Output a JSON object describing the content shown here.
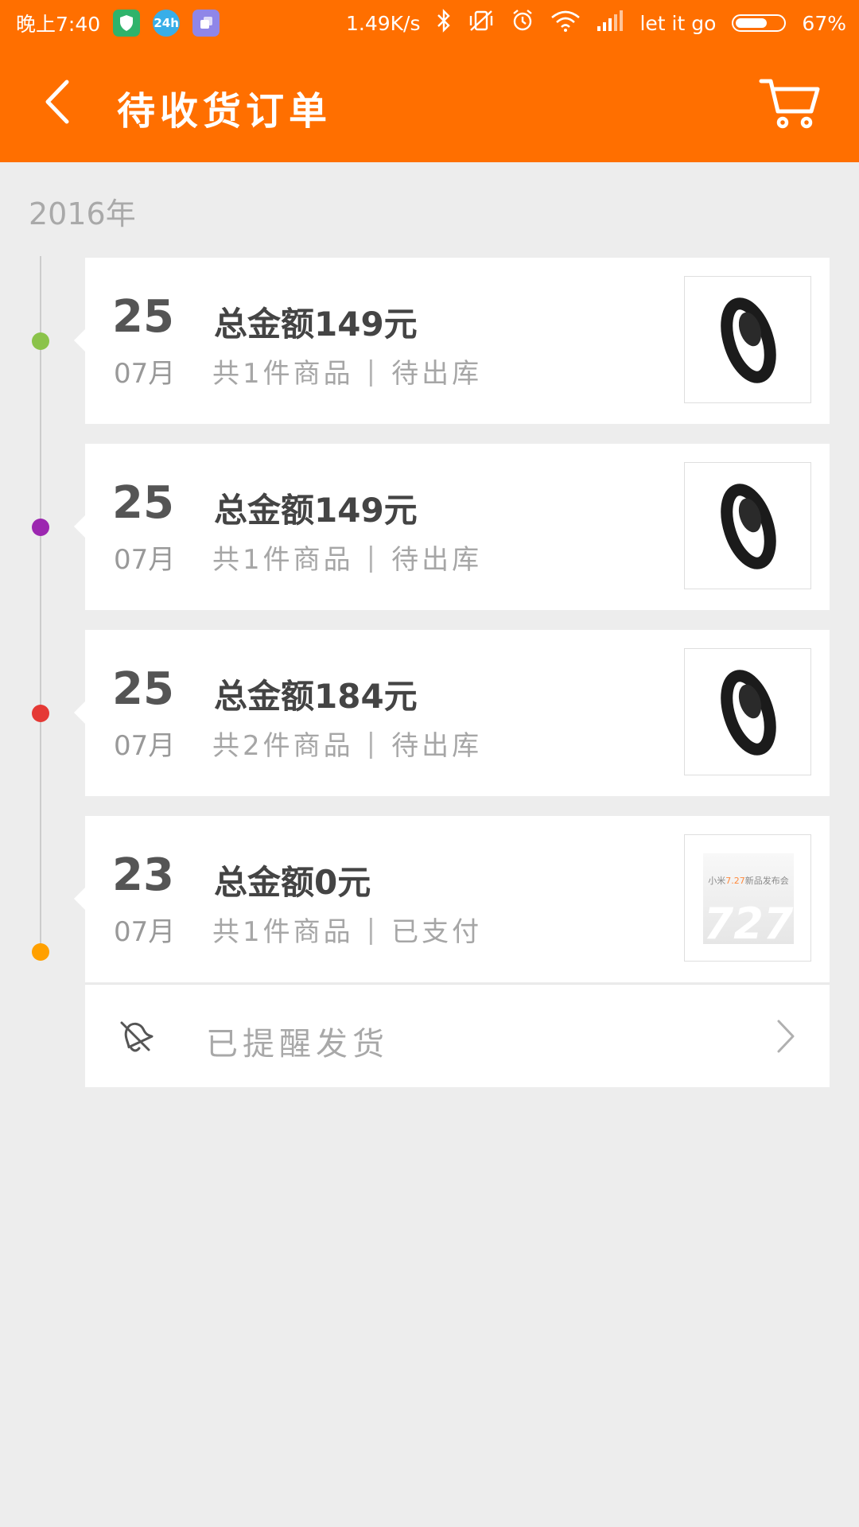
{
  "status_bar": {
    "time": "晚上7:40",
    "app_badge_24h": "24h",
    "net_speed": "1.49K/s",
    "carrier": "let it go",
    "battery_percent": "67%",
    "battery_level": 0.67,
    "colors": {
      "app1": "#2fb36b",
      "app2": "#38aee8",
      "app3": "#8f86e8"
    }
  },
  "header": {
    "title": "待收货订单",
    "back_icon": "chevron-left-icon",
    "cart_icon": "cart-icon",
    "background": "#ff6f00"
  },
  "year_label": "2016年",
  "orders": [
    {
      "day": "25",
      "month": "07月",
      "total": "总金额149元",
      "count": "共1件商品",
      "status": "待出库",
      "dot_color": "#8bc34a",
      "thumb": "band-image"
    },
    {
      "day": "25",
      "month": "07月",
      "total": "总金额149元",
      "count": "共1件商品",
      "status": "待出库",
      "dot_color": "#9c27b0",
      "thumb": "band-image"
    },
    {
      "day": "25",
      "month": "07月",
      "total": "总金额184元",
      "count": "共2件商品",
      "status": "待出库",
      "dot_color": "#e53935",
      "thumb": "band-image-stack"
    },
    {
      "day": "23",
      "month": "07月",
      "total": "总金额0元",
      "count": "共1件商品",
      "status": "已支付",
      "dot_color": "#ffa000",
      "thumb": "promo-image",
      "promo": {
        "prefix": "小米",
        "accent": "7.27",
        "suffix": "新品发布会",
        "big": "727"
      }
    }
  ],
  "reminder": {
    "label": "已提醒发货",
    "icon": "bell-icon",
    "chevron_icon": "chevron-right-icon"
  }
}
